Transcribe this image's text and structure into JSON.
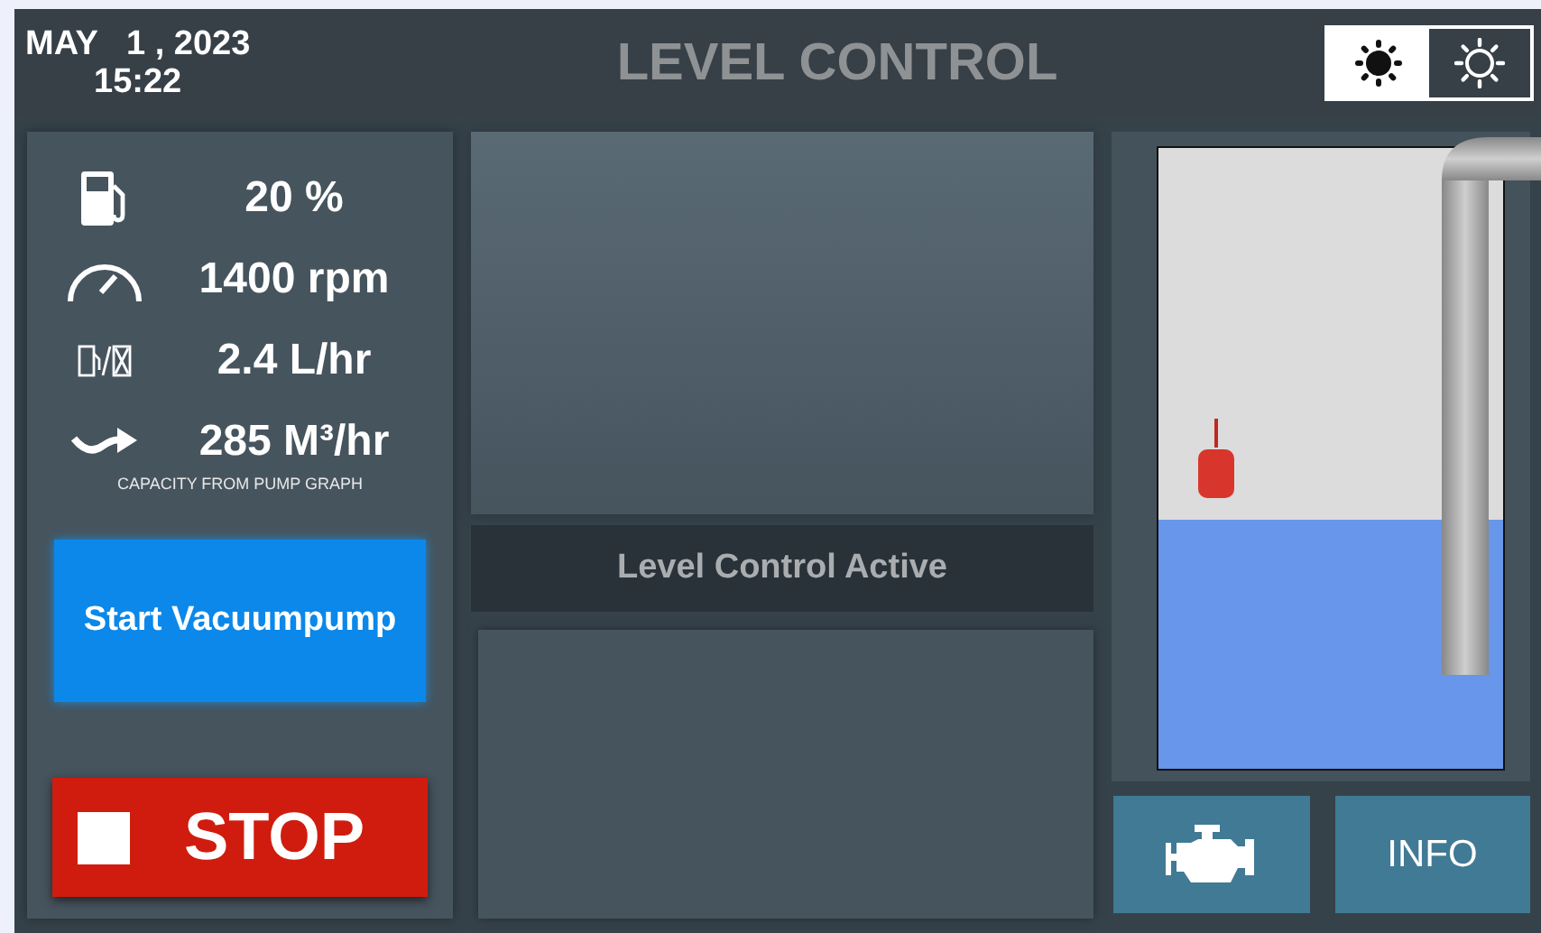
{
  "header": {
    "date": "MAY   1 , 2023",
    "time": "15:22",
    "title": "LEVEL CONTROL"
  },
  "brightness_buttons": [
    {
      "kind": "dim",
      "selected": true
    },
    {
      "kind": "bright",
      "selected": false
    }
  ],
  "readings": [
    {
      "kind": "fuel",
      "value": "20 %"
    },
    {
      "kind": "speed",
      "value": "1400 rpm"
    },
    {
      "kind": "consumption",
      "value": "2.4 L/hr"
    },
    {
      "kind": "flow",
      "value": "285 M³/hr"
    }
  ],
  "capacity_note": "CAPACITY FROM PUMP GRAPH",
  "start_button": "Start Vacuumpump",
  "stop_button": "STOP",
  "status": "Level Control Active",
  "tank": {
    "level": 0.4
  },
  "bottom_buttons": [
    {
      "kind": "engine"
    },
    {
      "kind": "text",
      "label": "INFO"
    }
  ]
}
